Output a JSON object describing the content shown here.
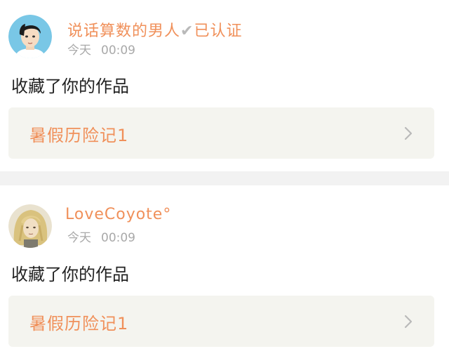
{
  "feed": [
    {
      "username": "说话算数的男人",
      "verified_label": "已认证",
      "date": "今天",
      "time": "00:09",
      "action": "收藏了你的作品",
      "work_title": "暑假历险记1",
      "avatar_icon": "avatar-cartoon-boy-icon"
    },
    {
      "username": "LoveCoyote°",
      "date": "今天",
      "time": "00:09",
      "action": "收藏了你的作品",
      "work_title": "暑假历险记1",
      "avatar_icon": "avatar-blonde-character-icon"
    }
  ],
  "colors": {
    "accent": "#f0905a",
    "meta_text": "#a9a9a9",
    "box_bg": "#f4f4ef",
    "separator": "#f2f2f2"
  }
}
